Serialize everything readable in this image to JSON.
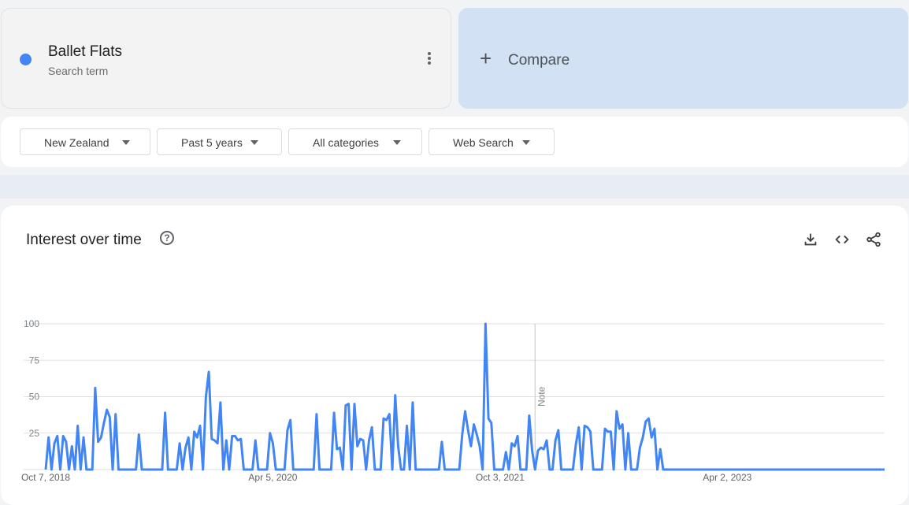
{
  "search_term": {
    "name": "Ballet Flats",
    "subtitle": "Search term",
    "color": "#4285f4"
  },
  "compare": {
    "plus": "+",
    "label": "Compare"
  },
  "filters": [
    {
      "label": "New Zealand"
    },
    {
      "label": "Past 5 years"
    },
    {
      "label": "All categories"
    },
    {
      "label": "Web Search"
    }
  ],
  "chart_card": {
    "title": "Interest over time",
    "help_icon": "?",
    "icons": [
      "download-icon",
      "embed-code-icon",
      "share-icon"
    ]
  },
  "chart_data": {
    "type": "line",
    "title": "Interest over time",
    "series": [
      {
        "name": "Ballet Flats",
        "color": "#4285f4",
        "values": [
          0,
          22,
          0,
          18,
          23,
          0,
          23,
          19,
          0,
          16,
          0,
          30,
          0,
          22,
          0,
          0,
          0,
          56,
          19,
          22,
          32,
          41,
          36,
          0,
          38,
          0,
          0,
          0,
          0,
          0,
          0,
          0,
          24,
          0,
          0,
          0,
          0,
          0,
          0,
          0,
          0,
          39,
          0,
          0,
          0,
          0,
          18,
          0,
          15,
          22,
          0,
          26,
          22,
          30,
          0,
          50,
          67,
          21,
          20,
          18,
          46,
          0,
          20,
          0,
          23,
          23,
          20,
          21,
          0,
          0,
          0,
          0,
          20,
          0,
          0,
          0,
          0,
          25,
          18,
          0,
          0,
          0,
          0,
          27,
          34,
          0,
          0,
          0,
          0,
          0,
          0,
          0,
          0,
          38,
          0,
          0,
          0,
          0,
          0,
          39,
          14,
          15,
          0,
          44,
          45,
          0,
          45,
          16,
          21,
          20,
          0,
          20,
          29,
          0,
          0,
          0,
          35,
          34,
          38,
          0,
          51,
          16,
          0,
          0,
          30,
          0,
          46,
          0,
          0,
          0,
          0,
          0,
          0,
          0,
          0,
          0,
          19,
          0,
          0,
          0,
          0,
          0,
          0,
          24,
          40,
          27,
          16,
          31,
          24,
          16,
          0,
          100,
          35,
          32,
          0,
          0,
          0,
          0,
          12,
          0,
          18,
          16,
          23,
          0,
          0,
          0,
          37,
          13,
          0,
          13,
          15,
          14,
          20,
          0,
          0,
          20,
          27,
          0,
          0,
          0,
          0,
          0,
          17,
          29,
          0,
          30,
          29,
          26,
          0,
          0,
          0,
          0,
          28,
          26,
          26,
          0,
          40,
          28,
          31,
          0,
          25,
          0,
          0,
          0,
          15,
          22,
          33,
          35,
          22,
          28,
          0,
          14,
          0,
          0,
          0,
          0,
          0,
          0,
          0,
          0,
          0,
          0,
          0,
          0,
          0,
          0,
          0,
          0,
          0,
          0,
          0,
          0,
          0,
          0,
          0,
          0,
          0,
          0,
          0,
          0,
          0,
          0,
          0,
          0,
          0,
          0,
          0,
          0,
          0,
          0,
          0,
          0,
          0,
          0,
          0,
          0,
          0,
          0,
          0,
          0,
          0,
          0,
          0,
          0,
          0,
          0,
          0,
          0,
          0,
          0,
          0,
          0,
          0,
          0,
          0,
          0,
          0,
          0,
          0,
          0,
          0,
          0,
          0,
          0,
          0,
          0,
          0,
          0,
          0
        ],
        "partial_last_points": 1
      }
    ],
    "x_tick_labels": [
      "Oct 7, 2018",
      "Apr 5, 2020",
      "Oct 3, 2021",
      "Apr 2, 2023"
    ],
    "x_tick_index": [
      0,
      78,
      156,
      234
    ],
    "y_ticks": [
      100,
      75,
      50,
      25
    ],
    "ylim": [
      0,
      100
    ],
    "annotations": [
      {
        "text": "Note",
        "at_index": 168
      }
    ],
    "grid": true
  }
}
